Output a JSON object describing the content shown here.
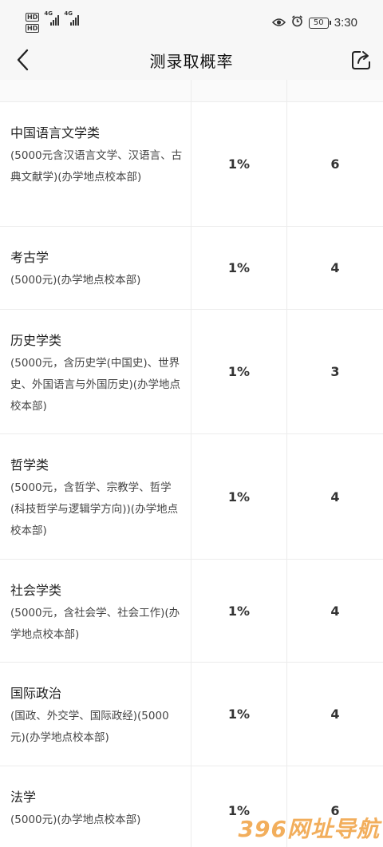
{
  "status_bar": {
    "hd1": "HD",
    "hd2": "HD",
    "net1": "4G",
    "net2": "4G",
    "battery": "50",
    "time": "3:30",
    "icons": [
      "eye-icon",
      "alarm-icon",
      "battery-icon"
    ]
  },
  "nav": {
    "title": "测录取概率",
    "back_icon": "back-arrow-icon",
    "share_icon": "share-icon"
  },
  "rows": [
    {
      "name": "中国语言文学类",
      "desc": "(5000元含汉语言文学、汉语言、古典文献学)(办学地点校本部)",
      "probability": "1%",
      "count": "6"
    },
    {
      "name": "考古学",
      "desc": "(5000元)(办学地点校本部)",
      "probability": "1%",
      "count": "4"
    },
    {
      "name": "历史学类",
      "desc": "(5000元，含历史学(中国史)、世界史、外国语言与外国历史)(办学地点校本部)",
      "probability": "1%",
      "count": "3"
    },
    {
      "name": "哲学类",
      "desc": "(5000元，含哲学、宗教学、哲学(科技哲学与逻辑学方向))(办学地点校本部)",
      "probability": "1%",
      "count": "4"
    },
    {
      "name": "社会学类",
      "desc": "(5000元，含社会学、社会工作)(办学地点校本部)",
      "probability": "1%",
      "count": "4"
    },
    {
      "name": "国际政治",
      "desc": "(国政、外交学、国际政经)(5000元)(办学地点校本部)",
      "probability": "1%",
      "count": "4"
    },
    {
      "name": "法学",
      "desc": "(5000元)(办学地点校本部)",
      "probability": "1%",
      "count": "6"
    }
  ],
  "watermark": "396网址导航"
}
